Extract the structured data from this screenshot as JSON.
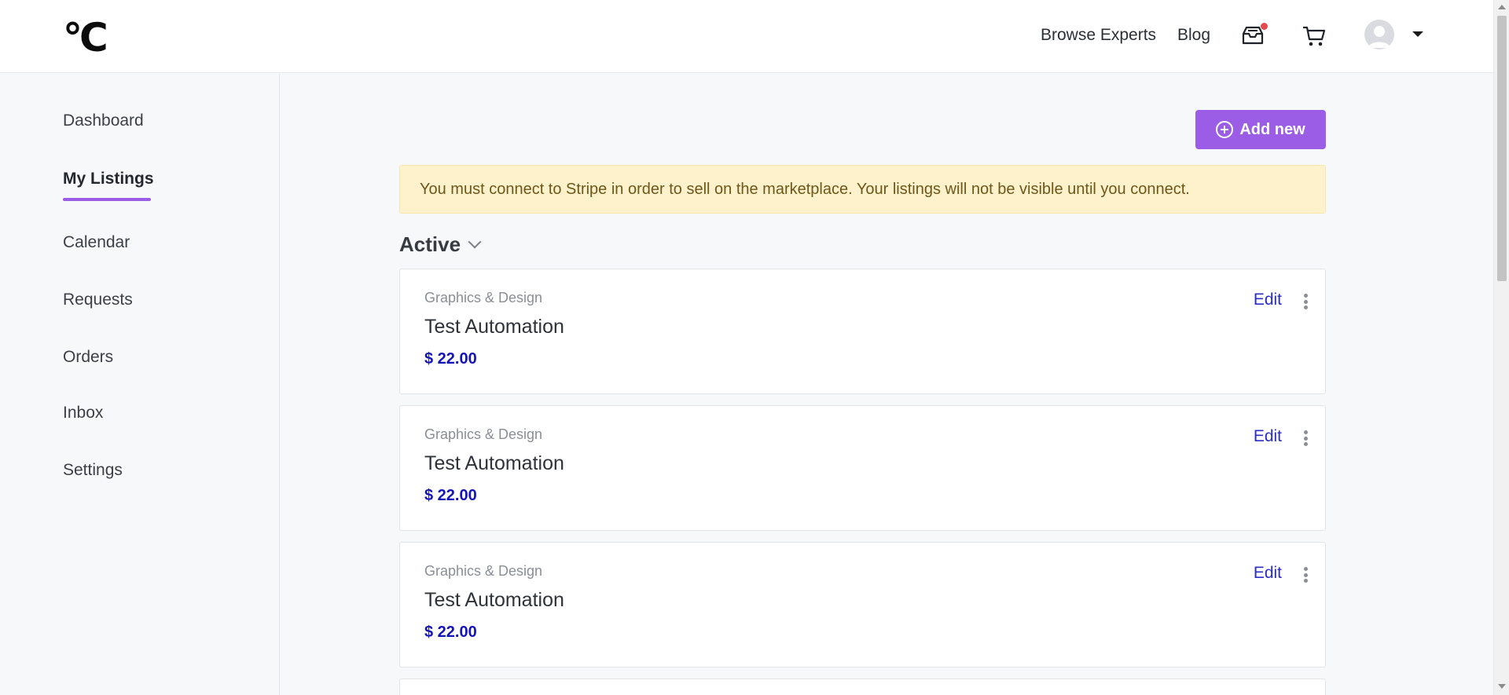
{
  "header": {
    "logo_text": "°C",
    "nav": [
      "Browse Experts",
      "Blog"
    ],
    "icons": [
      "inbox-tray-icon",
      "cart-icon",
      "avatar-icon",
      "caret-down-icon"
    ]
  },
  "sidebar": {
    "items": [
      {
        "label": "Dashboard"
      },
      {
        "label": "My Listings"
      },
      {
        "label": "Calendar"
      },
      {
        "label": "Requests"
      },
      {
        "label": "Orders"
      },
      {
        "label": "Inbox"
      },
      {
        "label": "Settings"
      }
    ],
    "active_item": "My Listings"
  },
  "main": {
    "add_button_label": "Add new",
    "banner_text": "You must connect to Stripe in order to sell on the marketplace. Your listings will not be visible until you connect.",
    "section_title": "Active",
    "listings": [
      {
        "category": "Graphics & Design",
        "title": "Test Automation",
        "price": "$ 22.00",
        "edit_label": "Edit"
      },
      {
        "category": "Graphics & Design",
        "title": "Test Automation",
        "price": "$ 22.00",
        "edit_label": "Edit"
      },
      {
        "category": "Graphics & Design",
        "title": "Test Automation",
        "price": "$ 22.00",
        "edit_label": "Edit"
      }
    ]
  },
  "colors": {
    "accent": "#9b5de5",
    "banner_bg": "#fdf2cc",
    "banner_text": "#6f5619",
    "price": "#1414b8",
    "link": "#2a2ec9",
    "notification": "#e5484d"
  }
}
